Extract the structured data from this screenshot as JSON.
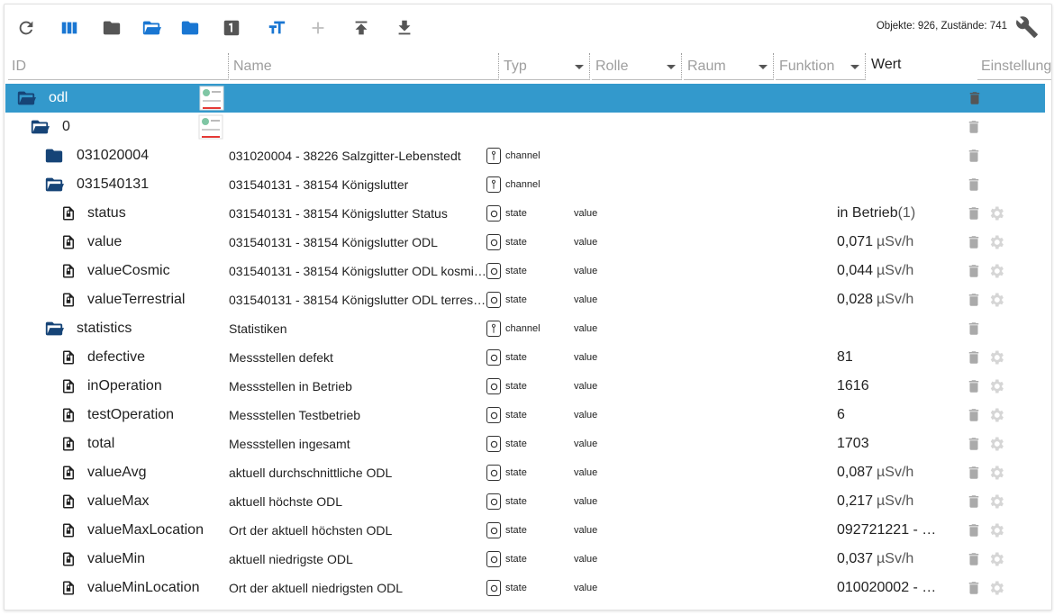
{
  "toolbar": {
    "buttons": [
      "refresh-icon",
      "columns-icon",
      "folder-icon",
      "folder-open-icon",
      "folder-icon",
      "number-one-icon",
      "text-size-icon",
      "add-icon",
      "upload-icon",
      "download-icon"
    ],
    "counts": "Objekte: 926, Zustände: 741"
  },
  "filters": {
    "id": "ID",
    "name": "Name",
    "typ": "Typ",
    "rolle": "Rolle",
    "raum": "Raum",
    "funktion": "Funktion",
    "wert": "Wert",
    "einstellung": "Einstellung"
  },
  "rows": [
    {
      "id": "odl",
      "name": "",
      "type": "",
      "role": "",
      "value": "",
      "unit": "",
      "icon": "folder-open"
    },
    {
      "id": "0",
      "name": "",
      "type": "",
      "role": "",
      "value": "",
      "unit": "",
      "icon": "folder-open"
    },
    {
      "id": "031020004",
      "name": "031020004 - 38226 Salzgitter-Lebenstedt",
      "type": "channel",
      "role": "",
      "value": "",
      "unit": "",
      "icon": "folder"
    },
    {
      "id": "031540131",
      "name": "031540131 - 38154 Königslutter",
      "type": "channel",
      "role": "",
      "value": "",
      "unit": "",
      "icon": "folder-open"
    },
    {
      "id": "status",
      "name": "031540131 - 38154 Königslutter Status",
      "type": "state",
      "role": "value",
      "value": "in Betrieb",
      "unit": "(1)",
      "icon": "file"
    },
    {
      "id": "value",
      "name": "031540131 - 38154 Königslutter ODL",
      "type": "state",
      "role": "value",
      "value": "0,071",
      "unit": "µSv/h",
      "icon": "file"
    },
    {
      "id": "valueCosmic",
      "name": "031540131 - 38154 Königslutter ODL kosmisch",
      "type": "state",
      "role": "value",
      "value": "0,044",
      "unit": "µSv/h",
      "icon": "file"
    },
    {
      "id": "valueTerrestrial",
      "name": "031540131 - 38154 Königslutter ODL terrestrisch",
      "type": "state",
      "role": "value",
      "value": "0,028",
      "unit": "µSv/h",
      "icon": "file"
    },
    {
      "id": "statistics",
      "name": "Statistiken",
      "type": "channel",
      "role": "value",
      "value": "",
      "unit": "",
      "icon": "folder-open"
    },
    {
      "id": "defective",
      "name": "Messstellen defekt",
      "type": "state",
      "role": "value",
      "value": "81",
      "unit": "",
      "icon": "file"
    },
    {
      "id": "inOperation",
      "name": "Messstellen in Betrieb",
      "type": "state",
      "role": "value",
      "value": "1616",
      "unit": "",
      "icon": "file"
    },
    {
      "id": "testOperation",
      "name": "Messstellen Testbetrieb",
      "type": "state",
      "role": "value",
      "value": "6",
      "unit": "",
      "icon": "file"
    },
    {
      "id": "total",
      "name": "Messstellen ingesamt",
      "type": "state",
      "role": "value",
      "value": "1703",
      "unit": "",
      "icon": "file"
    },
    {
      "id": "valueAvg",
      "name": "aktuell durchschnittliche ODL",
      "type": "state",
      "role": "value",
      "value": "0,087",
      "unit": "µSv/h",
      "icon": "file"
    },
    {
      "id": "valueMax",
      "name": "aktuell höchste ODL",
      "type": "state",
      "role": "value",
      "value": "0,217",
      "unit": "µSv/h",
      "icon": "file"
    },
    {
      "id": "valueMaxLocation",
      "name": "Ort der aktuell höchsten ODL",
      "type": "state",
      "role": "value",
      "value": "092721221 - …",
      "unit": "",
      "icon": "file"
    },
    {
      "id": "valueMin",
      "name": "aktuell niedrigste ODL",
      "type": "state",
      "role": "value",
      "value": "0,037",
      "unit": "µSv/h",
      "icon": "file"
    },
    {
      "id": "valueMinLocation",
      "name": "Ort der aktuell niedrigsten ODL",
      "type": "state",
      "role": "value",
      "value": "010020002 - …",
      "unit": "",
      "icon": "file"
    }
  ],
  "colors": {
    "selected": "#3399cc",
    "primary": "#1976d2",
    "folder": "#164477",
    "muted": "#9e9e9e"
  }
}
